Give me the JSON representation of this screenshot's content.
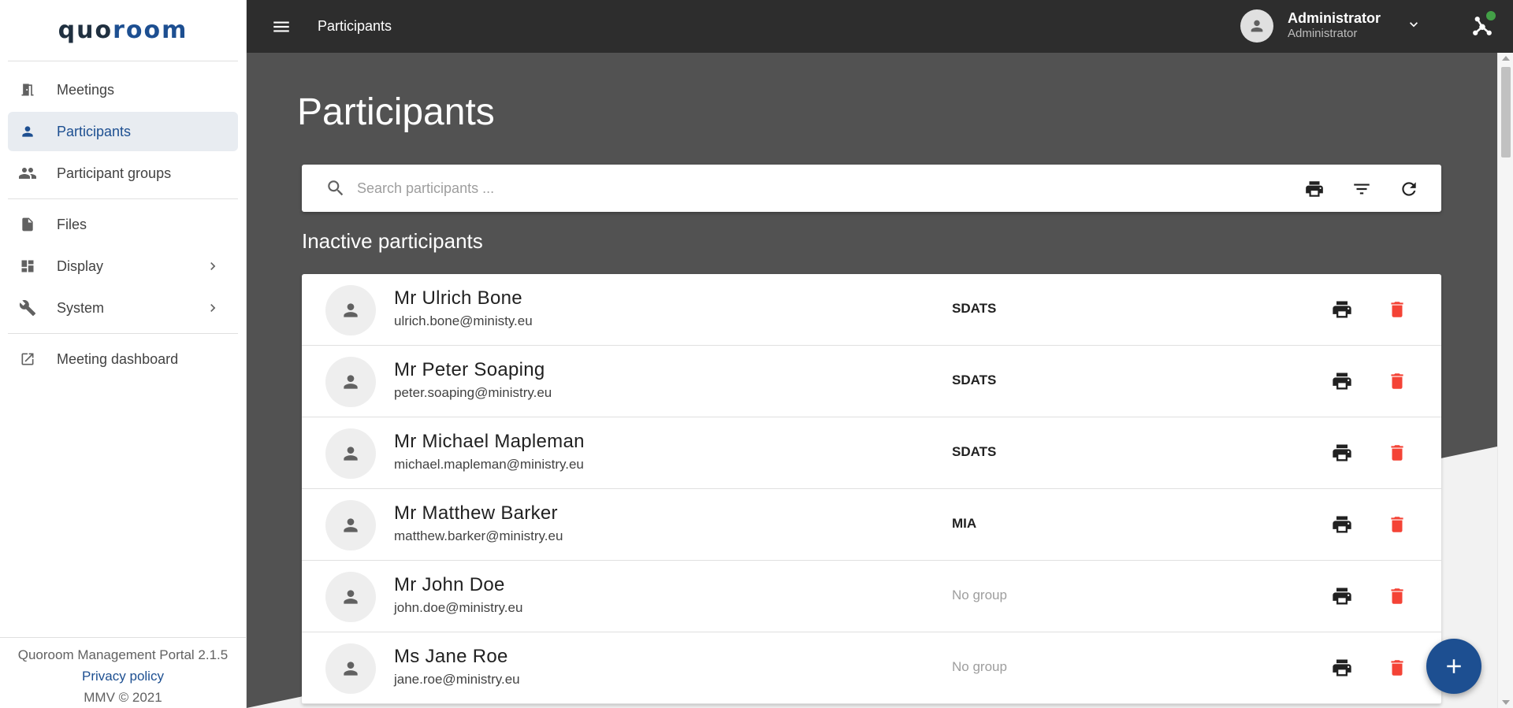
{
  "app": {
    "logo_text_left": "quo",
    "logo_text_accent": "room",
    "top_title": "Participants"
  },
  "colors": {
    "primary": "#1d4f91",
    "topbar": "#2d2d2d",
    "main_dark": "#525252",
    "delete": "#f44336",
    "online": "#43a047"
  },
  "sidebar": {
    "items": [
      {
        "label": "Meetings",
        "icon": "door-icon"
      },
      {
        "label": "Participants",
        "icon": "person-icon",
        "active": true
      },
      {
        "label": "Participant groups",
        "icon": "people-icon"
      },
      {
        "label": "Files",
        "icon": "file-icon"
      },
      {
        "label": "Display",
        "icon": "dashboard-icon"
      },
      {
        "label": "System",
        "icon": "wrench-icon"
      },
      {
        "label": "Meeting dashboard",
        "icon": "open-external-icon"
      }
    ],
    "footer": {
      "version": "Quoroom Management Portal 2.1.5",
      "privacy": "Privacy policy",
      "copyright": "MMV © 2021"
    }
  },
  "user": {
    "name": "Administrator",
    "role": "Administrator"
  },
  "main": {
    "title": "Participants",
    "search_placeholder": "Search participants ...",
    "section_title": "Inactive participants"
  },
  "participants": [
    {
      "name": "Mr Ulrich Bone",
      "email": "ulrich.bone@ministy.eu",
      "group": "SDATS"
    },
    {
      "name": "Mr Peter Soaping",
      "email": "peter.soaping@ministry.eu",
      "group": "SDATS"
    },
    {
      "name": "Mr Michael Mapleman",
      "email": "michael.mapleman@ministry.eu",
      "group": "SDATS"
    },
    {
      "name": "Mr Matthew Barker",
      "email": "matthew.barker@ministry.eu",
      "group": "MIA"
    },
    {
      "name": "Mr John Doe",
      "email": "john.doe@ministry.eu",
      "group": "No group"
    },
    {
      "name": "Ms Jane Roe",
      "email": "jane.roe@ministry.eu",
      "group": "No group"
    }
  ]
}
